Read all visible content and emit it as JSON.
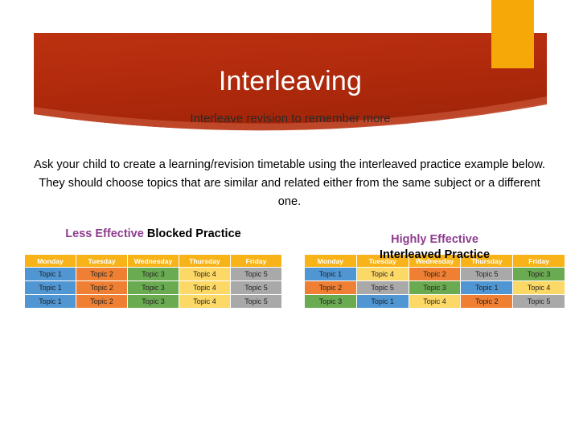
{
  "slide": {
    "title": "Interleaving",
    "subtitle": "Interleave revision to remember more",
    "body": "Ask your child to create a learning/revision timetable using the interleaved practice example below. They should choose topics that are similar and related either from the same subject or a different one."
  },
  "colors": {
    "banner_red": "#b02a0c",
    "banner_red_light": "#c0492b",
    "accent_orange": "#f7a809",
    "header_cell_yellow": "#f7b318",
    "heading_purple": "#8e3d8e",
    "topic1_blue": "#4f96d2",
    "topic2_orange": "#ef8033",
    "topic3_green": "#6aab52",
    "topic4_yellow": "#fcd866",
    "topic5_gray": "#a9a9a9"
  },
  "panels": [
    {
      "id": "blocked",
      "heading_emphasis": "Less Effective",
      "heading_rest": " Blocked Practice",
      "columns": [
        "Monday",
        "Tuesday",
        "Wednesday",
        "Thursday",
        "Friday"
      ],
      "rows": [
        [
          {
            "label": "Topic 1",
            "color": "c-blue"
          },
          {
            "label": "Topic 2",
            "color": "c-orange"
          },
          {
            "label": "Topic 3",
            "color": "c-green"
          },
          {
            "label": "Topic 4",
            "color": "c-yellow"
          },
          {
            "label": "Topic 5",
            "color": "c-gray"
          }
        ],
        [
          {
            "label": "Topic 1",
            "color": "c-blue"
          },
          {
            "label": "Topic 2",
            "color": "c-orange"
          },
          {
            "label": "Topic 3",
            "color": "c-green"
          },
          {
            "label": "Topic 4",
            "color": "c-yellow"
          },
          {
            "label": "Topic 5",
            "color": "c-gray"
          }
        ],
        [
          {
            "label": "Topic 1",
            "color": "c-blue"
          },
          {
            "label": "Topic 2",
            "color": "c-orange"
          },
          {
            "label": "Topic 3",
            "color": "c-green"
          },
          {
            "label": "Topic 4",
            "color": "c-yellow"
          },
          {
            "label": "Topic 5",
            "color": "c-gray"
          }
        ]
      ]
    },
    {
      "id": "interleaved",
      "heading_emphasis": "Highly Effective",
      "heading_rest": "Interleaved Practice",
      "columns": [
        "Monday",
        "Tuesday",
        "Wednesday",
        "Thursday",
        "Friday"
      ],
      "rows": [
        [
          {
            "label": "Topic 1",
            "color": "c-blue"
          },
          {
            "label": "Topic 4",
            "color": "c-yellow"
          },
          {
            "label": "Topic 2",
            "color": "c-orange"
          },
          {
            "label": "Topic 5",
            "color": "c-gray"
          },
          {
            "label": "Topic 3",
            "color": "c-green"
          }
        ],
        [
          {
            "label": "Topic 2",
            "color": "c-orange"
          },
          {
            "label": "Topic 5",
            "color": "c-gray"
          },
          {
            "label": "Topic 3",
            "color": "c-green"
          },
          {
            "label": "Topic 1",
            "color": "c-blue"
          },
          {
            "label": "Topic 4",
            "color": "c-yellow"
          }
        ],
        [
          {
            "label": "Topic 3",
            "color": "c-green"
          },
          {
            "label": "Topic 1",
            "color": "c-blue"
          },
          {
            "label": "Topic 4",
            "color": "c-yellow"
          },
          {
            "label": "Topic 2",
            "color": "c-orange"
          },
          {
            "label": "Topic 5",
            "color": "c-gray"
          }
        ]
      ]
    }
  ]
}
